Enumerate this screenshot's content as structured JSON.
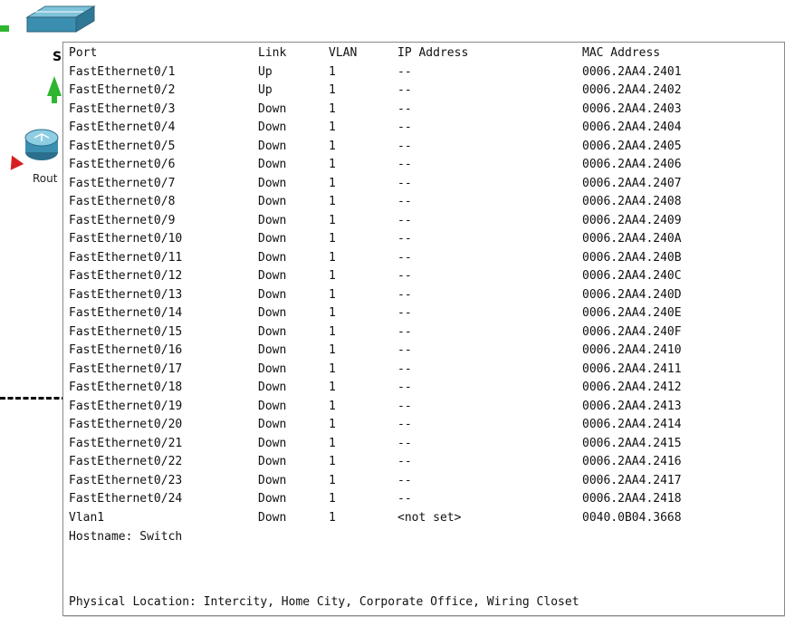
{
  "canvas": {
    "switch_label": "S",
    "router_label": "Rout"
  },
  "panel": {
    "headers": {
      "port": "Port",
      "link": "Link",
      "vlan": "VLAN",
      "ip": "IP Address",
      "mac": "MAC Address"
    },
    "rows": [
      {
        "port": "FastEthernet0/1",
        "link": "Up",
        "vlan": "1",
        "ip": "--",
        "mac": "0006.2AA4.2401"
      },
      {
        "port": "FastEthernet0/2",
        "link": "Up",
        "vlan": "1",
        "ip": "--",
        "mac": "0006.2AA4.2402"
      },
      {
        "port": "FastEthernet0/3",
        "link": "Down",
        "vlan": "1",
        "ip": "--",
        "mac": "0006.2AA4.2403"
      },
      {
        "port": "FastEthernet0/4",
        "link": "Down",
        "vlan": "1",
        "ip": "--",
        "mac": "0006.2AA4.2404"
      },
      {
        "port": "FastEthernet0/5",
        "link": "Down",
        "vlan": "1",
        "ip": "--",
        "mac": "0006.2AA4.2405"
      },
      {
        "port": "FastEthernet0/6",
        "link": "Down",
        "vlan": "1",
        "ip": "--",
        "mac": "0006.2AA4.2406"
      },
      {
        "port": "FastEthernet0/7",
        "link": "Down",
        "vlan": "1",
        "ip": "--",
        "mac": "0006.2AA4.2407"
      },
      {
        "port": "FastEthernet0/8",
        "link": "Down",
        "vlan": "1",
        "ip": "--",
        "mac": "0006.2AA4.2408"
      },
      {
        "port": "FastEthernet0/9",
        "link": "Down",
        "vlan": "1",
        "ip": "--",
        "mac": "0006.2AA4.2409"
      },
      {
        "port": "FastEthernet0/10",
        "link": "Down",
        "vlan": "1",
        "ip": "--",
        "mac": "0006.2AA4.240A"
      },
      {
        "port": "FastEthernet0/11",
        "link": "Down",
        "vlan": "1",
        "ip": "--",
        "mac": "0006.2AA4.240B"
      },
      {
        "port": "FastEthernet0/12",
        "link": "Down",
        "vlan": "1",
        "ip": "--",
        "mac": "0006.2AA4.240C"
      },
      {
        "port": "FastEthernet0/13",
        "link": "Down",
        "vlan": "1",
        "ip": "--",
        "mac": "0006.2AA4.240D"
      },
      {
        "port": "FastEthernet0/14",
        "link": "Down",
        "vlan": "1",
        "ip": "--",
        "mac": "0006.2AA4.240E"
      },
      {
        "port": "FastEthernet0/15",
        "link": "Down",
        "vlan": "1",
        "ip": "--",
        "mac": "0006.2AA4.240F"
      },
      {
        "port": "FastEthernet0/16",
        "link": "Down",
        "vlan": "1",
        "ip": "--",
        "mac": "0006.2AA4.2410"
      },
      {
        "port": "FastEthernet0/17",
        "link": "Down",
        "vlan": "1",
        "ip": "--",
        "mac": "0006.2AA4.2411"
      },
      {
        "port": "FastEthernet0/18",
        "link": "Down",
        "vlan": "1",
        "ip": "--",
        "mac": "0006.2AA4.2412"
      },
      {
        "port": "FastEthernet0/19",
        "link": "Down",
        "vlan": "1",
        "ip": "--",
        "mac": "0006.2AA4.2413"
      },
      {
        "port": "FastEthernet0/20",
        "link": "Down",
        "vlan": "1",
        "ip": "--",
        "mac": "0006.2AA4.2414"
      },
      {
        "port": "FastEthernet0/21",
        "link": "Down",
        "vlan": "1",
        "ip": "--",
        "mac": "0006.2AA4.2415"
      },
      {
        "port": "FastEthernet0/22",
        "link": "Down",
        "vlan": "1",
        "ip": "--",
        "mac": "0006.2AA4.2416"
      },
      {
        "port": "FastEthernet0/23",
        "link": "Down",
        "vlan": "1",
        "ip": "--",
        "mac": "0006.2AA4.2417"
      },
      {
        "port": "FastEthernet0/24",
        "link": "Down",
        "vlan": "1",
        "ip": "--",
        "mac": "0006.2AA4.2418"
      },
      {
        "port": "Vlan1",
        "link": "Down",
        "vlan": "1",
        "ip": "<not set>",
        "mac": "0040.0B04.3668"
      }
    ],
    "hostname": "Hostname: Switch",
    "location": "Physical Location: Intercity, Home City, Corporate Office, Wiring Closet"
  },
  "colors": {
    "link_up_green": "#2fb52f",
    "link_down_red": "#d61f1f",
    "switch_teal": "#3a8fb0"
  },
  "icons": [
    "switch-icon",
    "router-icon"
  ]
}
